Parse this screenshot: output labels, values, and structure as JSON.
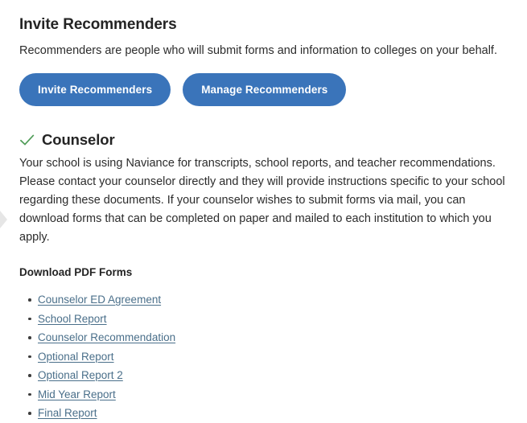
{
  "theme": {
    "background": "#ffffff",
    "button_blue": "#3a74ba",
    "link_blue": "#4a6f8a",
    "heading_color": "#242424",
    "body_color": "#2c2c2c",
    "check_green": "#4f9c57",
    "edge_chevron_gray": "#e3e3e3"
  },
  "invite_section": {
    "title": "Invite Recommenders",
    "subtitle": "Recommenders are people who will submit forms and information to colleges on your behalf.",
    "buttons": [
      {
        "label": "Invite Recommenders",
        "name": "invite-recommenders-button"
      },
      {
        "label": "Manage Recommenders",
        "name": "manage-recommenders-button"
      }
    ]
  },
  "counselor_section": {
    "status_icon": "check-icon",
    "title": "Counselor",
    "body": "Your school is using Naviance for transcripts, school reports, and teacher recommendations. Please contact your counselor directly and they will provide instructions specific to your school regarding these documents. If your counselor wishes to submit forms via mail, you can download forms that can be completed on paper and mailed to each institution to which you apply.",
    "forms_heading": "Download PDF Forms",
    "forms": [
      "Counselor ED Agreement",
      "School Report",
      "Counselor Recommendation",
      "Optional Report",
      "Optional Report 2",
      "Mid Year Report",
      "Final Report"
    ]
  },
  "edge_control": {
    "icon": "chevron-right-icon"
  }
}
